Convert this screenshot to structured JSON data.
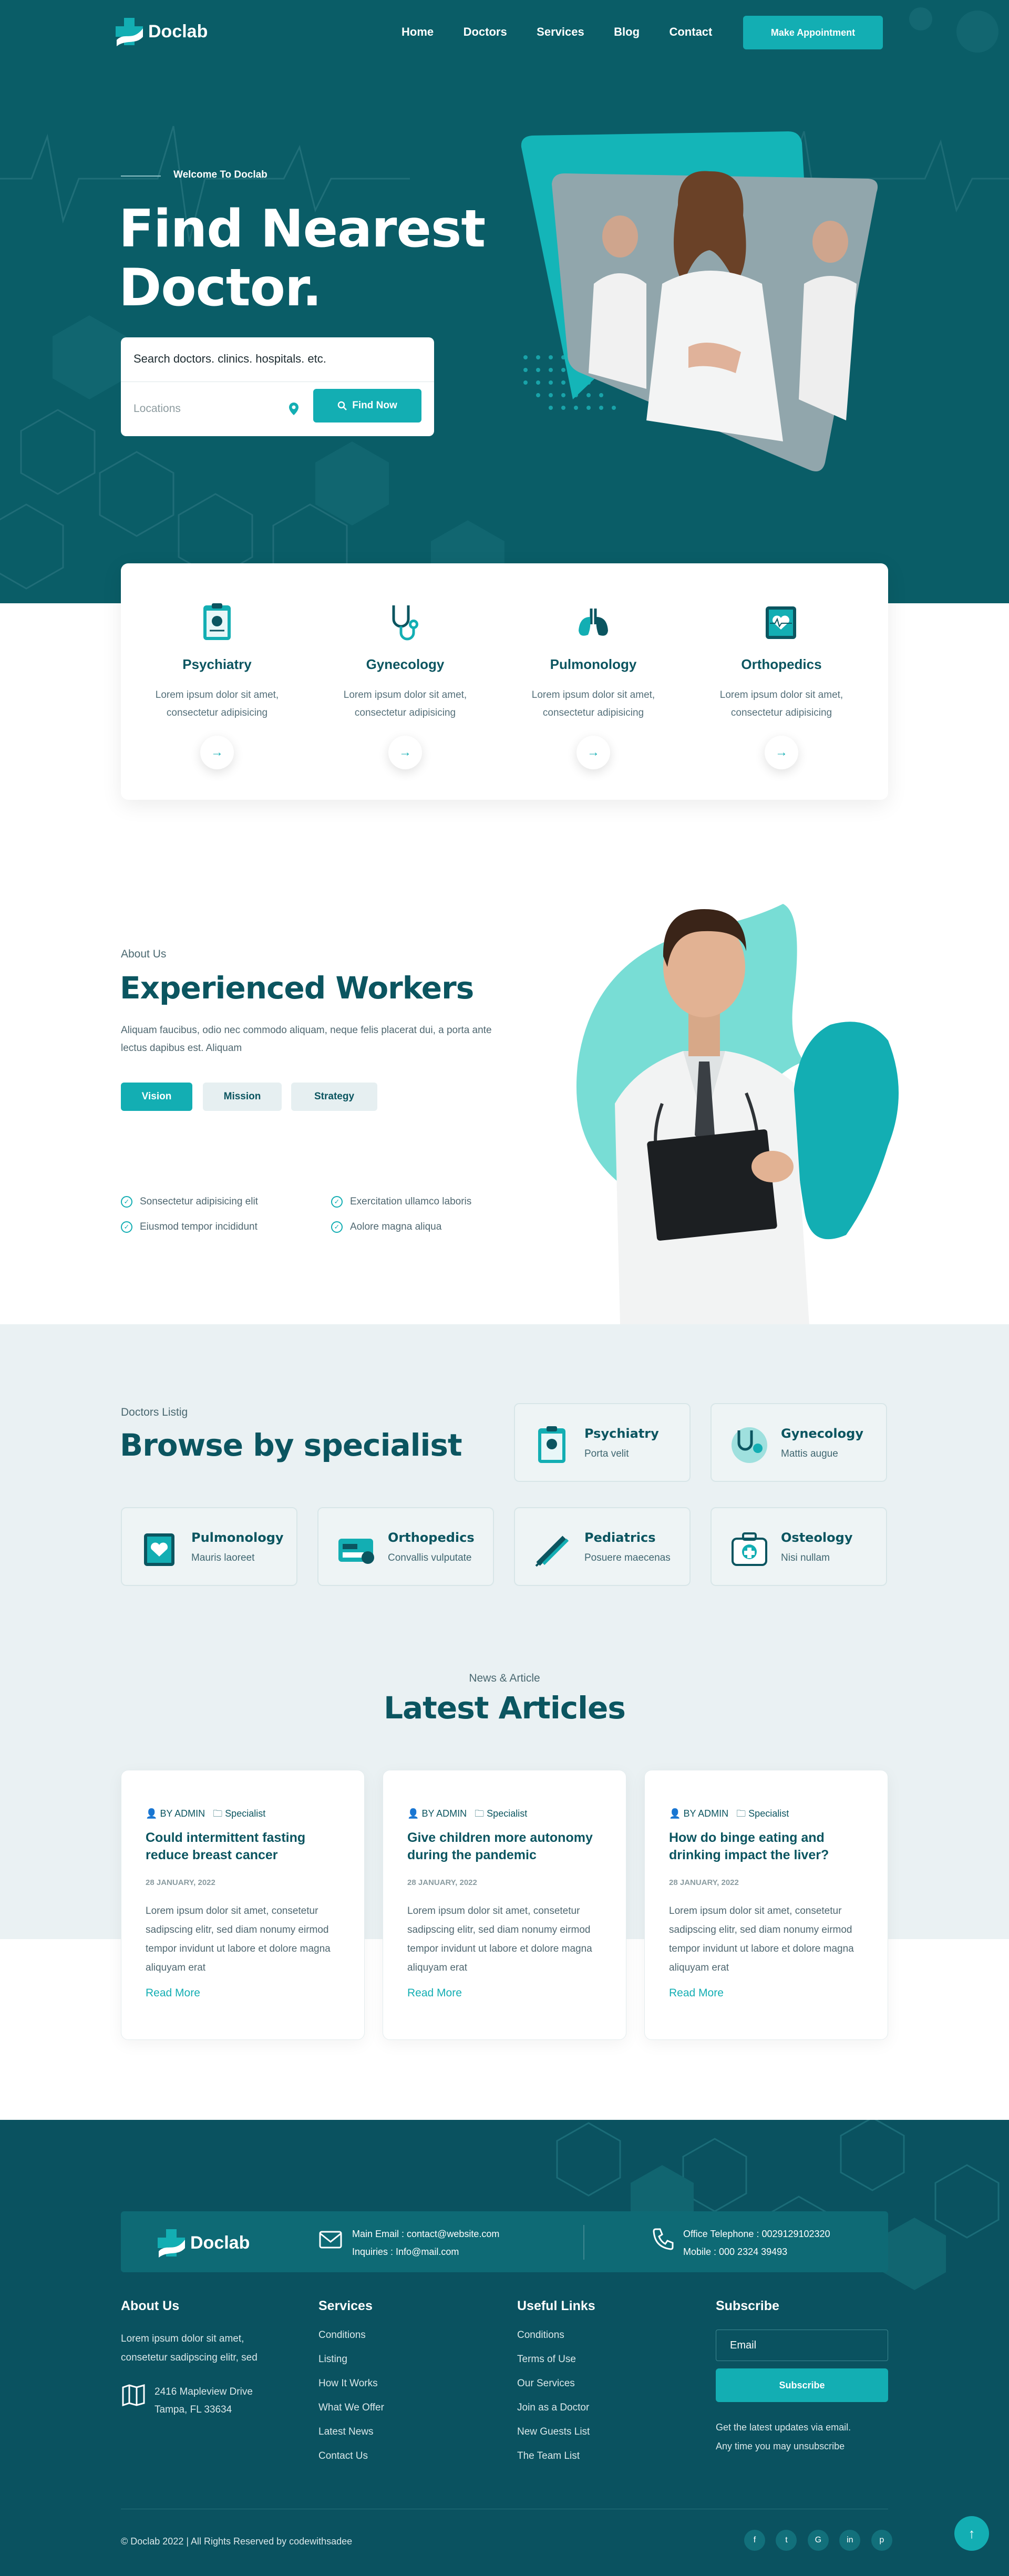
{
  "header": {
    "logo": "Doclab",
    "nav": [
      "Home",
      "Doctors",
      "Services",
      "Blog",
      "Contact"
    ],
    "cta": "Make Appointment"
  },
  "hero": {
    "eyebrow": "Welcome To Doclab",
    "title_l1": "Find Nearest",
    "title_l2": "Doctor.",
    "search_placeholder": "Search doctors. clinics. hospitals. etc.",
    "location_placeholder": "Locations",
    "find_button": "Find Now"
  },
  "services": [
    {
      "title": "Psychiatry",
      "text_l1": "Lorem ipsum dolor sit amet,",
      "text_l2": "consectetur adipisicing",
      "icon": "clipboard-brain-icon"
    },
    {
      "title": "Gynecology",
      "text_l1": "Lorem ipsum dolor sit amet,",
      "text_l2": "consectetur adipisicing",
      "icon": "stethoscope-icon"
    },
    {
      "title": "Pulmonology",
      "text_l1": "Lorem ipsum dolor sit amet,",
      "text_l2": "consectetur adipisicing",
      "icon": "lungs-icon"
    },
    {
      "title": "Orthopedics",
      "text_l1": "Lorem ipsum dolor sit amet,",
      "text_l2": "consectetur adipisicing",
      "icon": "heart-monitor-icon"
    }
  ],
  "about": {
    "eyebrow": "About Us",
    "title": "Experienced Workers",
    "text_l1": "Aliquam faucibus, odio nec commodo aliquam, neque felis placerat dui, a porta ante",
    "text_l2": "lectus dapibus est. Aliquam",
    "tabs": [
      "Vision",
      "Mission",
      "Strategy"
    ],
    "checks": [
      "Sonsectetur adipisicing elit",
      "Exercitation ullamco laboris",
      "Eiusmod tempor incididunt",
      "Aolore magna aliqua"
    ]
  },
  "specialists": {
    "eyebrow": "Doctors Listig",
    "title": "Browse by specialist",
    "items": [
      {
        "name": "Psychiatry",
        "sub": "Porta velit"
      },
      {
        "name": "Gynecology",
        "sub": "Mattis augue"
      },
      {
        "name": "Pulmonology",
        "sub": "Mauris laoreet"
      },
      {
        "name": "Orthopedics",
        "sub": "Convallis vulputate"
      },
      {
        "name": "Pediatrics",
        "sub": "Posuere maecenas"
      },
      {
        "name": "Osteology",
        "sub": "Nisi nullam"
      }
    ]
  },
  "articles": {
    "eyebrow": "News & Article",
    "title": "Latest Articles",
    "items": [
      {
        "author": "BY ADMIN",
        "category": "Specialist",
        "title": "Could intermittent fasting reduce breast cancer",
        "date": "28 JANUARY, 2022",
        "text": "Lorem ipsum dolor sit amet, consetetur sadipscing elitr, sed diam nonumy eirmod tempor invidunt ut labore et dolore magna aliquyam erat",
        "more": "Read More"
      },
      {
        "author": "BY ADMIN",
        "category": "Specialist",
        "title": "Give children more autonomy during the pandemic",
        "date": "28 JANUARY, 2022",
        "text": "Lorem ipsum dolor sit amet, consetetur sadipscing elitr, sed diam nonumy eirmod tempor invidunt ut labore et dolore magna aliquyam erat",
        "more": "Read More"
      },
      {
        "author": "BY ADMIN",
        "category": "Specialist",
        "title": "How do binge eating and drinking impact the liver?",
        "date": "28 JANUARY, 2022",
        "text": "Lorem ipsum dolor sit amet, consetetur sadipscing elitr, sed diam nonumy eirmod tempor invidunt ut labore et dolore magna aliquyam erat",
        "more": "Read More"
      }
    ]
  },
  "footer": {
    "logo": "Doclab",
    "email_line": "Main Email : contact@website.com",
    "inquiries_line": "Inquiries : Info@mail.com",
    "phone_line": "Office Telephone : 0029129102320",
    "mobile_line": "Mobile : 000 2324 39493",
    "about_title": "About Us",
    "about_text_l1": "Lorem ipsum dolor sit amet,",
    "about_text_l2": "consetetur sadipscing elitr, sed",
    "address_l1": "2416 Mapleview Drive",
    "address_l2": "Tampa, FL 33634",
    "services_title": "Services",
    "services": [
      "Conditions",
      "Listing",
      "How It Works",
      "What We Offer",
      "Latest News",
      "Contact Us"
    ],
    "links_title": "Useful Links",
    "links": [
      "Conditions",
      "Terms of Use",
      "Our Services",
      "Join as a Doctor",
      "New Guests List",
      "The Team List"
    ],
    "subscribe_title": "Subscribe",
    "email_placeholder": "Email",
    "subscribe_button": "Subscribe",
    "subscribe_note_l1": "Get the latest updates via email.",
    "subscribe_note_l2": "Any time you may unsubscribe",
    "copyright": "© Doclab 2022 | All Rights Reserved by codewithsadee",
    "social": [
      "facebook-icon",
      "twitter-icon",
      "google-icon",
      "linkedin-icon",
      "pinterest-icon"
    ]
  },
  "colors": {
    "primary_dark": "#0a5d67",
    "accent": "#13aeb3",
    "light_bg": "#eaf1f3"
  }
}
